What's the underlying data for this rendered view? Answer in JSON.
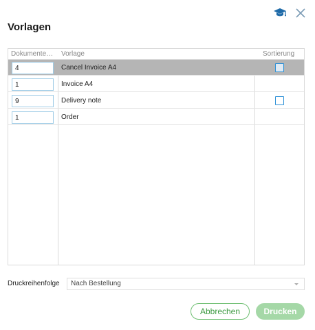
{
  "dialog": {
    "title": "Vorlagen",
    "icons": {
      "help": "graduation-cap-icon",
      "close": "close-icon"
    }
  },
  "grid": {
    "headers": {
      "count": "Dokumente…",
      "template": "Vorlage",
      "sort": "Sortierung"
    },
    "rows": [
      {
        "count": "4",
        "template": "Cancel Invoice A4",
        "has_checkbox": true,
        "checked": false,
        "selected": true
      },
      {
        "count": "1",
        "template": "Invoice A4",
        "has_checkbox": false,
        "checked": false,
        "selected": false
      },
      {
        "count": "9",
        "template": "Delivery note",
        "has_checkbox": true,
        "checked": false,
        "selected": false
      },
      {
        "count": "1",
        "template": "Order",
        "has_checkbox": false,
        "checked": false,
        "selected": false
      }
    ]
  },
  "print_order": {
    "label": "Druckreihenfolge",
    "value": "Nach Bestellung"
  },
  "buttons": {
    "cancel": "Abbrechen",
    "print": "Drucken"
  },
  "colors": {
    "accent_green": "#3d9a42",
    "disabled_green": "#a5d8a7",
    "checkbox_blue": "#2a8fd6",
    "help_icon": "#1e6aa8",
    "selected_row": "#b5b5b5"
  }
}
